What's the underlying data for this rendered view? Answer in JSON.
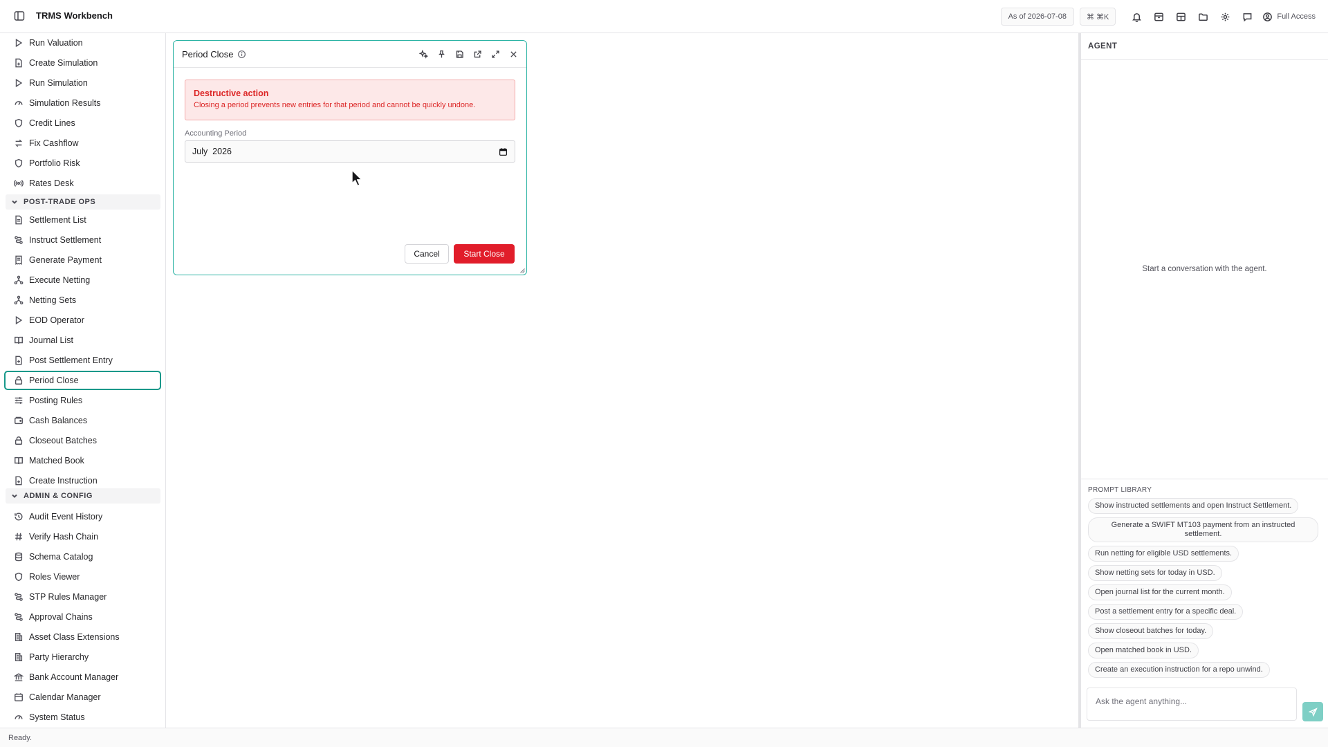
{
  "app": {
    "title": "TRMS Workbench",
    "as_of": "As of 2026-07-08",
    "shortcut": "⌘ ⌘K",
    "access": "Full Access"
  },
  "sidebar": {
    "items_top": [
      {
        "label": "Run Valuation",
        "icon": "play-icon"
      },
      {
        "label": "Create Simulation",
        "icon": "file-plus-icon"
      },
      {
        "label": "Run Simulation",
        "icon": "play-icon"
      },
      {
        "label": "Simulation Results",
        "icon": "gauge-icon"
      },
      {
        "label": "Credit Lines",
        "icon": "shield-icon"
      },
      {
        "label": "Fix Cashflow",
        "icon": "arrows-icon"
      },
      {
        "label": "Portfolio Risk",
        "icon": "shield-icon"
      },
      {
        "label": "Rates Desk",
        "icon": "radio-icon"
      }
    ],
    "group_post_trade": "POST-TRADE OPS",
    "items_post_trade": [
      {
        "label": "Settlement List",
        "icon": "document-icon"
      },
      {
        "label": "Instruct Settlement",
        "icon": "route-icon"
      },
      {
        "label": "Generate Payment",
        "icon": "receipt-icon"
      },
      {
        "label": "Execute Netting",
        "icon": "network-icon"
      },
      {
        "label": "Netting Sets",
        "icon": "network-icon"
      },
      {
        "label": "EOD Operator",
        "icon": "play-icon"
      },
      {
        "label": "Journal List",
        "icon": "book-icon"
      },
      {
        "label": "Post Settlement Entry",
        "icon": "file-plus-icon"
      },
      {
        "label": "Period Close",
        "icon": "lock-icon"
      },
      {
        "label": "Posting Rules",
        "icon": "sliders-icon"
      },
      {
        "label": "Cash Balances",
        "icon": "wallet-icon"
      },
      {
        "label": "Closeout Batches",
        "icon": "lock-icon"
      },
      {
        "label": "Matched Book",
        "icon": "book-icon"
      },
      {
        "label": "Create Instruction",
        "icon": "file-plus-icon"
      }
    ],
    "group_admin": "ADMIN & CONFIG",
    "items_admin": [
      {
        "label": "Audit Event History",
        "icon": "history-icon"
      },
      {
        "label": "Verify Hash Chain",
        "icon": "hash-icon"
      },
      {
        "label": "Schema Catalog",
        "icon": "database-icon"
      },
      {
        "label": "Roles Viewer",
        "icon": "shield-icon"
      },
      {
        "label": "STP Rules Manager",
        "icon": "route-icon"
      },
      {
        "label": "Approval Chains",
        "icon": "route-icon"
      },
      {
        "label": "Asset Class Extensions",
        "icon": "building-icon"
      },
      {
        "label": "Party Hierarchy",
        "icon": "building-icon"
      },
      {
        "label": "Bank Account Manager",
        "icon": "bank-icon"
      },
      {
        "label": "Calendar Manager",
        "icon": "calendar-icon"
      },
      {
        "label": "System Status",
        "icon": "gauge-icon"
      }
    ]
  },
  "dialog": {
    "title": "Period Close",
    "alert_title": "Destructive action",
    "alert_body": "Closing a period prevents new entries for that period and cannot be quickly undone.",
    "field_label": "Accounting Period",
    "field_value": "July  2026",
    "cancel": "Cancel",
    "confirm": "Start Close"
  },
  "agent": {
    "header": "AGENT",
    "empty": "Start a conversation with the agent.",
    "library_title": "PROMPT LIBRARY",
    "prompts": [
      "Show instructed settlements and open Instruct Settlement.",
      "Generate a SWIFT MT103 payment from an instructed settlement.",
      "Run netting for eligible USD settlements.",
      "Show netting sets for today in USD.",
      "Open journal list for the current month.",
      "Post a settlement entry for a specific deal.",
      "Show closeout batches for today.",
      "Open matched book in USD.",
      "Create an execution instruction for a repo unwind."
    ],
    "input_placeholder": "Ask the agent anything..."
  },
  "status": "Ready.",
  "colors": {
    "accent": "#16988a",
    "danger": "#e11d2a",
    "alert_bg": "#fde8e8"
  }
}
